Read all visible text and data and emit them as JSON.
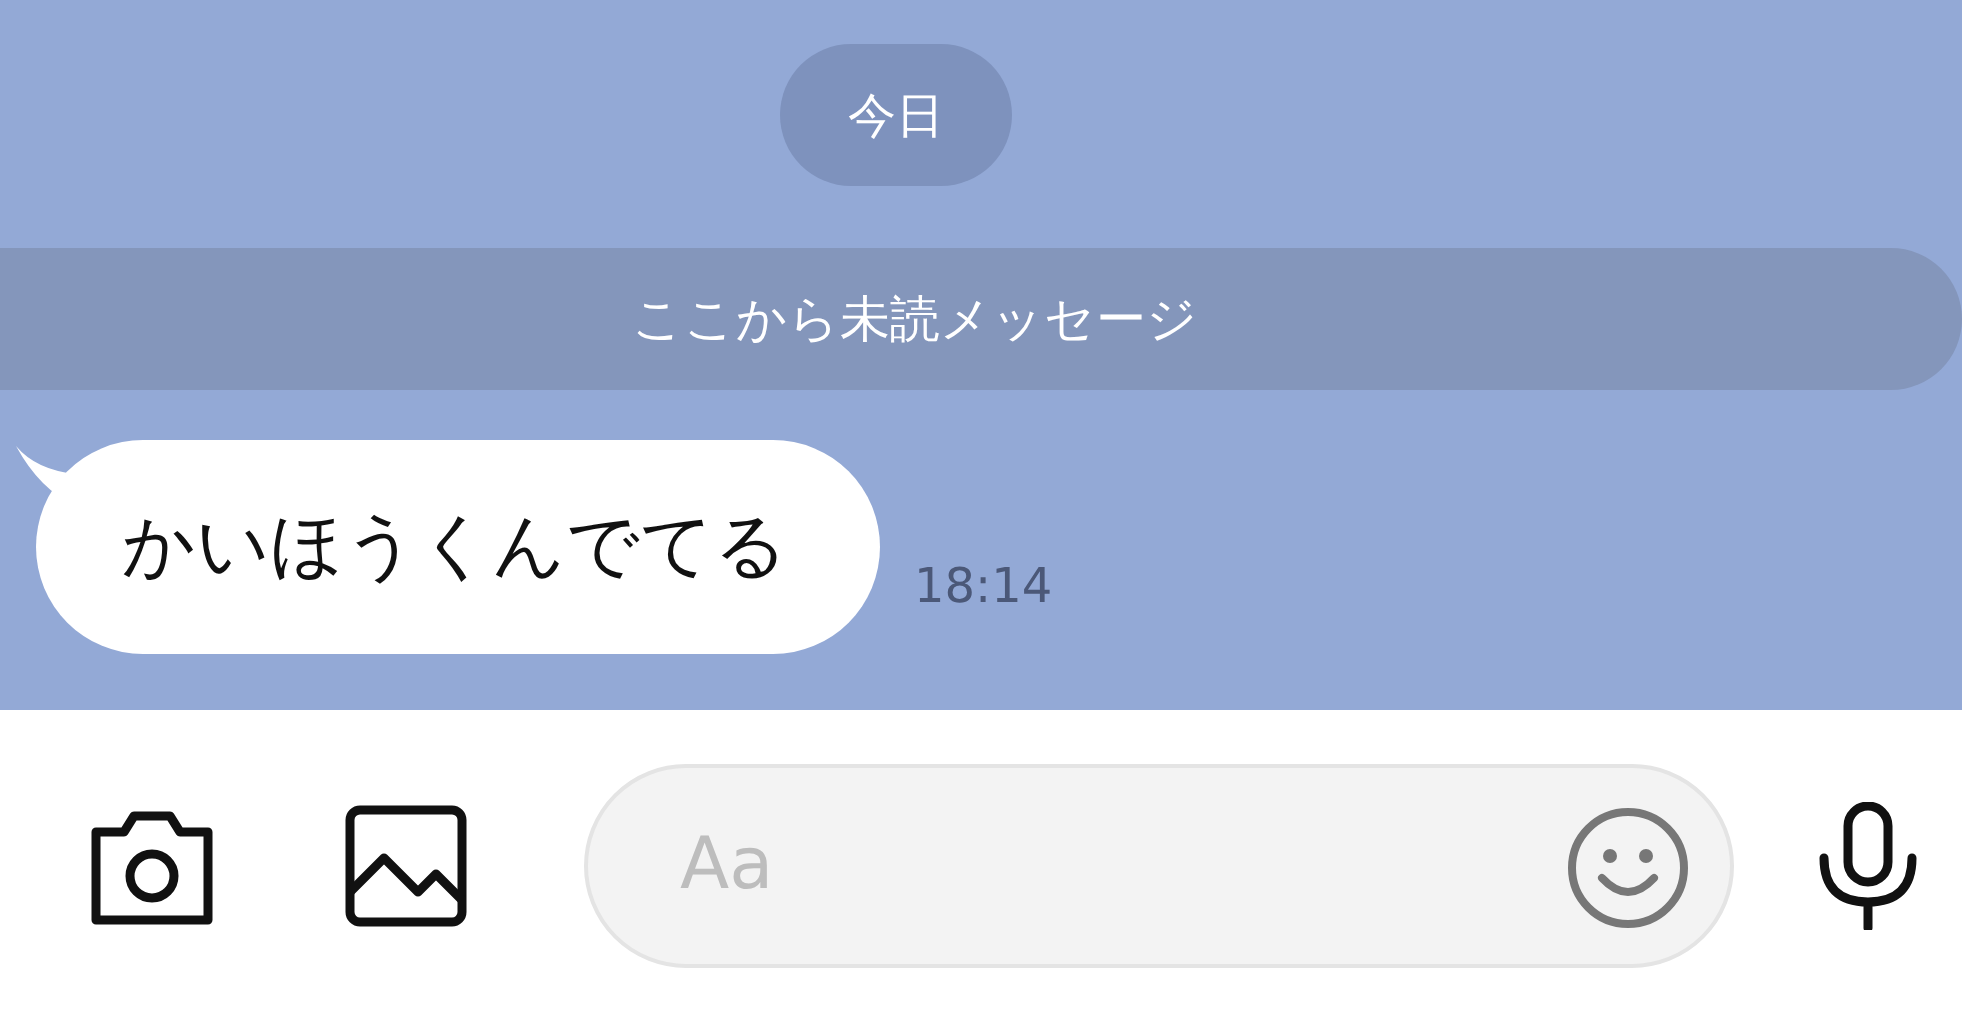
{
  "date_label": "今日",
  "unread_divider": "ここから未読メッセージ",
  "messages": [
    {
      "text": "かいほうくんでてる",
      "time": "18:14"
    }
  ],
  "composer": {
    "placeholder": "Aa"
  }
}
